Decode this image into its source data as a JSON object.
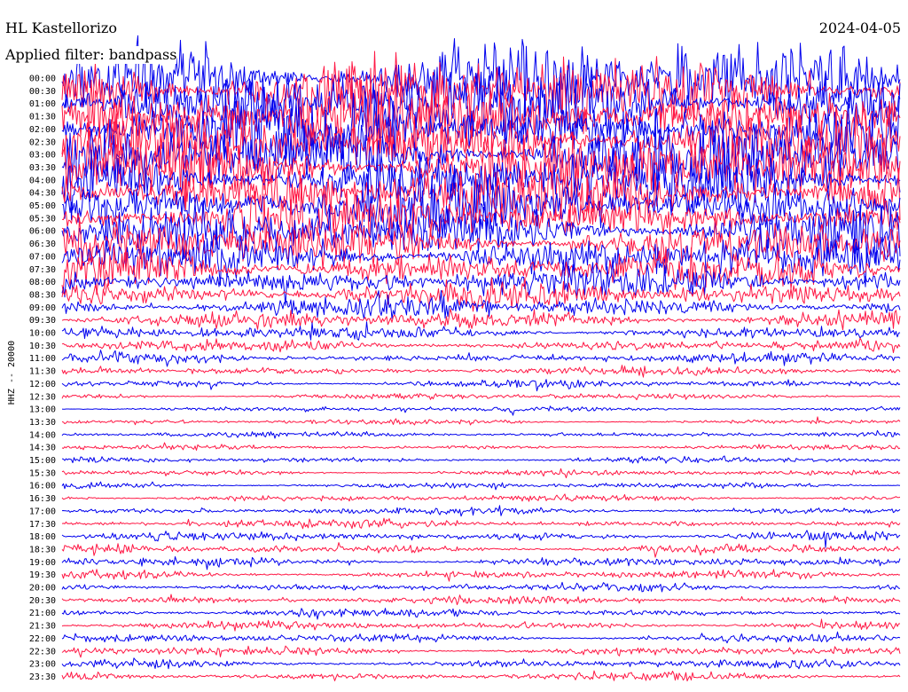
{
  "header": {
    "station": "HL Kastellorizo",
    "filter": "Applied filter: bandpass",
    "date": "2024-04-05"
  },
  "colors": {
    "trace_a": "#0000ee",
    "trace_b": "#ff1744",
    "background": "#ffffff",
    "text": "#000000"
  },
  "chart_data": {
    "type": "line",
    "title": "HL Kastellorizo",
    "ylabel": "HHZ -- 20000",
    "series": [
      {
        "name": "00:00",
        "amplitude": 95,
        "color": "#0000ee"
      },
      {
        "name": "00:30",
        "amplitude": 95,
        "color": "#ff1744"
      },
      {
        "name": "01:00",
        "amplitude": 92,
        "color": "#0000ee"
      },
      {
        "name": "01:30",
        "amplitude": 92,
        "color": "#ff1744"
      },
      {
        "name": "02:00",
        "amplitude": 90,
        "color": "#0000ee"
      },
      {
        "name": "02:30",
        "amplitude": 88,
        "color": "#ff1744"
      },
      {
        "name": "03:00",
        "amplitude": 85,
        "color": "#0000ee"
      },
      {
        "name": "03:30",
        "amplitude": 82,
        "color": "#ff1744"
      },
      {
        "name": "04:00",
        "amplitude": 78,
        "color": "#0000ee"
      },
      {
        "name": "04:30",
        "amplitude": 75,
        "color": "#ff1744"
      },
      {
        "name": "05:00",
        "amplitude": 70,
        "color": "#0000ee"
      },
      {
        "name": "05:30",
        "amplitude": 66,
        "color": "#ff1744"
      },
      {
        "name": "06:00",
        "amplitude": 62,
        "color": "#0000ee"
      },
      {
        "name": "06:30",
        "amplitude": 58,
        "color": "#ff1744"
      },
      {
        "name": "07:00",
        "amplitude": 52,
        "color": "#0000ee"
      },
      {
        "name": "07:30",
        "amplitude": 46,
        "color": "#ff1744"
      },
      {
        "name": "08:00",
        "amplitude": 40,
        "color": "#0000ee"
      },
      {
        "name": "08:30",
        "amplitude": 34,
        "color": "#ff1744"
      },
      {
        "name": "09:00",
        "amplitude": 28,
        "color": "#0000ee"
      },
      {
        "name": "09:30",
        "amplitude": 22,
        "color": "#ff1744"
      },
      {
        "name": "10:00",
        "amplitude": 16,
        "color": "#0000ee"
      },
      {
        "name": "10:30",
        "amplitude": 14,
        "color": "#ff1744"
      },
      {
        "name": "11:00",
        "amplitude": 12,
        "color": "#0000ee"
      },
      {
        "name": "11:30",
        "amplitude": 11,
        "color": "#ff1744"
      },
      {
        "name": "12:00",
        "amplitude": 9,
        "color": "#0000ee"
      },
      {
        "name": "12:30",
        "amplitude": 7,
        "color": "#ff1744"
      },
      {
        "name": "13:00",
        "amplitude": 6,
        "color": "#0000ee"
      },
      {
        "name": "13:30",
        "amplitude": 6,
        "color": "#ff1744"
      },
      {
        "name": "14:00",
        "amplitude": 7,
        "color": "#0000ee"
      },
      {
        "name": "14:30",
        "amplitude": 6,
        "color": "#ff1744"
      },
      {
        "name": "15:00",
        "amplitude": 7,
        "color": "#0000ee"
      },
      {
        "name": "15:30",
        "amplitude": 7,
        "color": "#ff1744"
      },
      {
        "name": "16:00",
        "amplitude": 7,
        "color": "#0000ee"
      },
      {
        "name": "16:30",
        "amplitude": 8,
        "color": "#ff1744"
      },
      {
        "name": "17:00",
        "amplitude": 9,
        "color": "#0000ee"
      },
      {
        "name": "17:30",
        "amplitude": 10,
        "color": "#ff1744"
      },
      {
        "name": "18:00",
        "amplitude": 11,
        "color": "#0000ee"
      },
      {
        "name": "18:30",
        "amplitude": 11,
        "color": "#ff1744"
      },
      {
        "name": "19:00",
        "amplitude": 11,
        "color": "#0000ee"
      },
      {
        "name": "19:30",
        "amplitude": 10,
        "color": "#ff1744"
      },
      {
        "name": "20:00",
        "amplitude": 10,
        "color": "#0000ee"
      },
      {
        "name": "20:30",
        "amplitude": 10,
        "color": "#ff1744"
      },
      {
        "name": "21:00",
        "amplitude": 10,
        "color": "#0000ee"
      },
      {
        "name": "21:30",
        "amplitude": 10,
        "color": "#ff1744"
      },
      {
        "name": "22:00",
        "amplitude": 10,
        "color": "#0000ee"
      },
      {
        "name": "22:30",
        "amplitude": 10,
        "color": "#ff1744"
      },
      {
        "name": "23:00",
        "amplitude": 10,
        "color": "#0000ee"
      },
      {
        "name": "23:30",
        "amplitude": 10,
        "color": "#ff1744"
      }
    ],
    "grid": false,
    "legend": "none"
  }
}
